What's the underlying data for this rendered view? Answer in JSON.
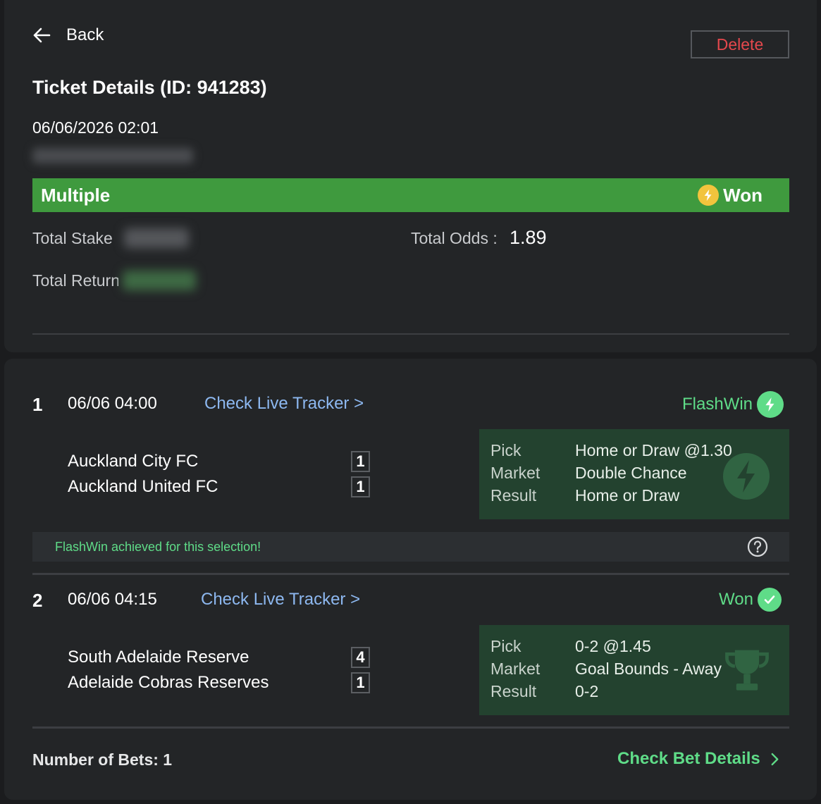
{
  "header": {
    "back_label": "Back",
    "delete_label": "Delete",
    "title": "Ticket Details (ID: 941283)",
    "date": "06/06/2026 02:01"
  },
  "status_bar": {
    "bet_type": "Multiple",
    "status": "Won",
    "color": "#3f9a3e"
  },
  "totals": {
    "stake_label": "Total Stake",
    "return_label": "Total Return",
    "odds_label": "Total Odds :",
    "odds_value": "1.89"
  },
  "selections": [
    {
      "number": "1",
      "time": "06/06 04:00",
      "tracker_label": "Check Live Tracker >",
      "status": "FlashWin",
      "status_icon": "bolt-icon",
      "home_team": "Auckland City FC",
      "away_team": "Auckland United FC",
      "home_score": "1",
      "away_score": "1",
      "pick_label": "Pick",
      "pick_value": "Home or Draw @1.30",
      "market_label": "Market",
      "market_value": "Double Chance",
      "result_label": "Result",
      "result_value": "Home or Draw",
      "notice": "FlashWin achieved for this selection!"
    },
    {
      "number": "2",
      "time": "06/06 04:15",
      "tracker_label": "Check Live Tracker >",
      "status": "Won",
      "status_icon": "check-icon",
      "home_team": "South Adelaide Reserve",
      "away_team": "Adelaide Cobras Reserves",
      "home_score": "4",
      "away_score": "1",
      "pick_label": "Pick",
      "pick_value": "0-2 @1.45",
      "market_label": "Market",
      "market_value": "Goal Bounds - Away",
      "result_label": "Result",
      "result_value": "0-2"
    }
  ],
  "footer": {
    "num_bets": "Number of Bets: 1",
    "bet_details_label": "Check Bet Details"
  },
  "colors": {
    "accent_green": "#5fdc88",
    "link_blue": "#8db8f0",
    "delete_red": "#e5484d"
  }
}
